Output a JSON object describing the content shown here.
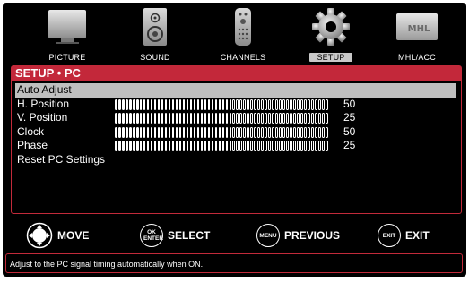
{
  "top_menu": {
    "items": [
      {
        "label": "PICTURE",
        "icon": "tv-icon"
      },
      {
        "label": "SOUND",
        "icon": "speaker-icon"
      },
      {
        "label": "CHANNELS",
        "icon": "remote-icon"
      },
      {
        "label": "SETUP",
        "icon": "gear-icon",
        "active": true
      },
      {
        "label": "MHL/ACC",
        "icon": "mhl-logo"
      }
    ],
    "mhl_logo_text": "MHL"
  },
  "panel": {
    "title": "SETUP • PC",
    "rows": [
      {
        "label": "Auto Adjust",
        "selected": true
      },
      {
        "label": "H. Position",
        "value": "50",
        "level": 0.5
      },
      {
        "label": "V. Position",
        "value": "25",
        "level": 0.25
      },
      {
        "label": "Clock",
        "value": "50",
        "level": 0.5
      },
      {
        "label": "Phase",
        "value": "25",
        "level": 0.25
      },
      {
        "label": "Reset PC Settings"
      }
    ]
  },
  "nav": {
    "move": "MOVE",
    "select": "SELECT",
    "select_btn": "OK ENTER",
    "previous": "PREVIOUS",
    "previous_btn": "MENU",
    "exit": "EXIT",
    "exit_btn": "EXIT"
  },
  "description": "Adjust to the PC signal timing automatically when ON.",
  "colors": {
    "accent": "#c3283a",
    "selection": "#bfbfbf"
  }
}
